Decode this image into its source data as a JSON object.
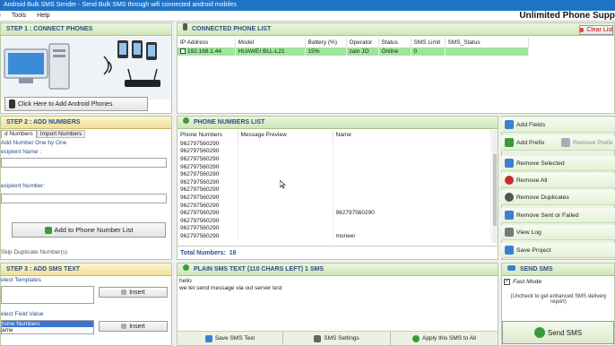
{
  "window": {
    "title": "Android Bulk SMS Sender - Send Bulk SMS through wifi connected android mobiles",
    "menu": [
      "e",
      "Tools",
      "Help"
    ],
    "banner": "Unlimited Phone Supp"
  },
  "step1": {
    "title": "STEP 1 : CONNECT PHONES",
    "connect_button": "Click Here to Add Android Phones"
  },
  "connected": {
    "title": "CONNECTED PHONE LIST",
    "clear_button": "Clear List",
    "columns": [
      "IP Address",
      "Model",
      "Battery (%)",
      "Operator",
      "Status",
      "SMS Limit",
      "SMS_Status"
    ],
    "rows": [
      [
        "192.168.1.44",
        "HUAWEI BLL-L21",
        "15%",
        "zain JO",
        "Online",
        "0",
        ""
      ]
    ]
  },
  "step2": {
    "title": "STEP 2 : ADD NUMBERS",
    "tabs": [
      "d Numbers",
      "Import Numbers"
    ],
    "subtitle": "Add Number One by One",
    "recipient_name_label": "ecipient Name :",
    "recipient_number_label": "ecipient Number:",
    "add_button": "Add to Phone Number List",
    "skip_label": "Skip Duplicate Number(s)"
  },
  "numbers": {
    "title": "PHONE NUMBERS LIST",
    "columns": [
      "Phone Numbers",
      "Message Preview",
      "Name"
    ],
    "rows": [
      [
        "962797560290",
        "",
        ""
      ],
      [
        "962797560290",
        "",
        ""
      ],
      [
        "962797560290",
        "",
        ""
      ],
      [
        "962797560290",
        "",
        ""
      ],
      [
        "962797560290",
        "",
        ""
      ],
      [
        "962797560290",
        "",
        ""
      ],
      [
        "962797560290",
        "",
        ""
      ],
      [
        "962797560290",
        "",
        ""
      ],
      [
        "962797560290",
        "",
        ""
      ],
      [
        "962797560290",
        "",
        "962797560290"
      ],
      [
        "962797560290",
        "",
        ""
      ],
      [
        "962797560290",
        "",
        ""
      ],
      [
        "962797560290",
        "",
        "moneer"
      ]
    ],
    "total_label": "Total Numbers:",
    "total_value": "16"
  },
  "side": {
    "add_fields": "Add Fields",
    "add_prefix": "Add Prefix",
    "remove_prefix": "Remove Prefix",
    "remove_selected": "Remove Selected",
    "remove_all": "Remove All",
    "remove_duplicates": "Remove Duplicates",
    "remove_sent": "Remove Sent or Failed",
    "view_log": "View Log",
    "save_project": "Save Project"
  },
  "step3": {
    "title": "STEP 3 : ADD SMS TEXT",
    "templates_label": "elect Templates",
    "insert1": "Insert",
    "field_value_label": "elect Field Value",
    "field_options": [
      "hone Numbers",
      "ame"
    ],
    "insert2": "Insert"
  },
  "sms": {
    "title": "PLAIN SMS TEXT (110 CHARS LEFT) 1 SMS",
    "text_line1": "hello",
    "text_line2": "we tet send message  via out  server test",
    "save_text": "Save SMS Text",
    "settings": "SMS Settings",
    "apply": "Apply this SMS to All"
  },
  "send": {
    "title": "SEND SMS",
    "fast_mode": "Fast Mode",
    "hint": "(Uncheck to get enhanced SMS delivery report)",
    "send_button": "Send SMS"
  },
  "colors": {
    "accent": "#1f73c7",
    "header": "#2a4f88",
    "selected_row": "#9de59a"
  }
}
